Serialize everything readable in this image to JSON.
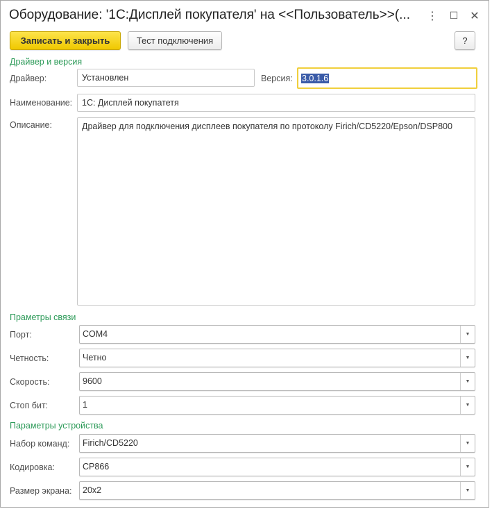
{
  "window": {
    "title": "Оборудование: '1С:Дисплей покупателя' на <<Пользователь>>(...",
    "more_icon": "⋮",
    "maximize_icon": "☐",
    "close_icon": "✕"
  },
  "toolbar": {
    "save_close": "Записать и закрыть",
    "test_connection": "Тест подключения",
    "help": "?"
  },
  "driver_section": {
    "title": "Драйвер и версия",
    "driver_label": "Драйвер:",
    "driver_value": "Установлен",
    "version_label": "Версия:",
    "version_value": "3.0.1.6",
    "name_label": "Наименование:",
    "name_value": "1С: Дисплей покупатетя",
    "description_label": "Описание:",
    "description_value": "Драйвер для подключения дисплеев покупателя по протоколу Firich/CD5220/Epson/DSP800"
  },
  "connection_section": {
    "title": "Праметры связи",
    "fields": [
      {
        "label": "Порт:",
        "value": "COM4"
      },
      {
        "label": "Четность:",
        "value": "Четно"
      },
      {
        "label": "Скорость:",
        "value": "9600"
      },
      {
        "label": "Стоп бит:",
        "value": "1"
      }
    ]
  },
  "device_section": {
    "title": "Параметры устройства",
    "fields": [
      {
        "label": "Набор команд:",
        "value": "Firich/CD5220"
      },
      {
        "label": "Кодировка:",
        "value": "CP866"
      },
      {
        "label": "Размер экрана:",
        "value": "20x2"
      }
    ]
  },
  "colors": {
    "accent": "#f0c800",
    "section": "#2c9a58",
    "selection": "#3a5ba8"
  }
}
